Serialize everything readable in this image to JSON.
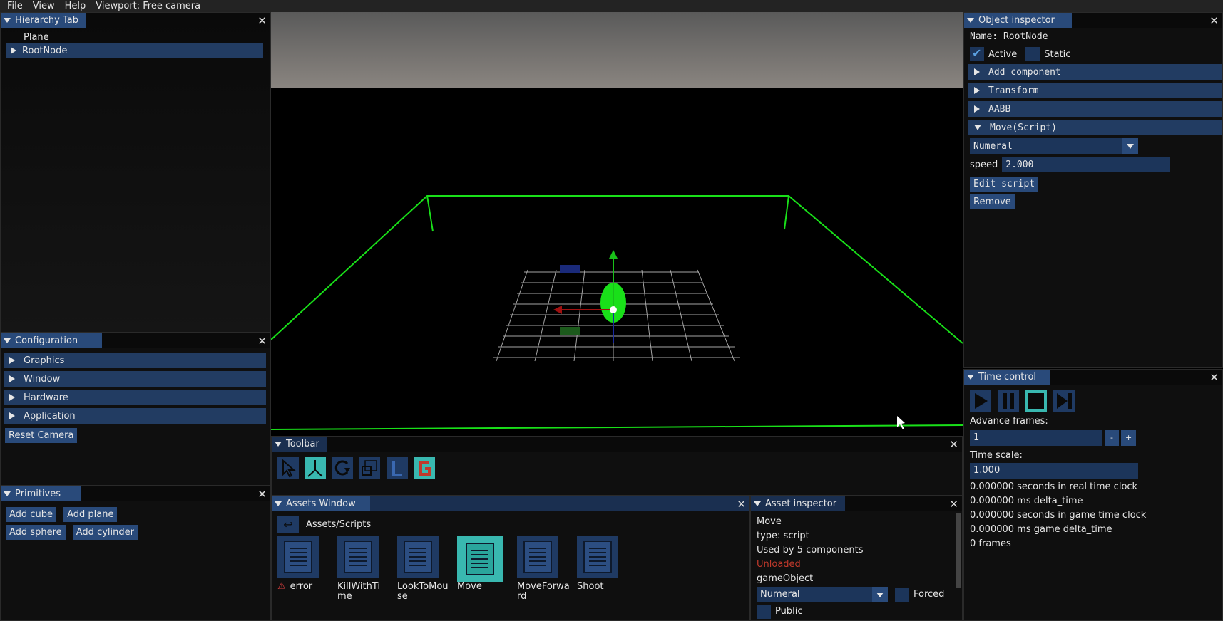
{
  "menu": {
    "file": "File",
    "view": "View",
    "help": "Help",
    "viewport": "Viewport: Free camera"
  },
  "hierarchy": {
    "title": "Hierarchy Tab",
    "items": [
      {
        "label": "Plane"
      },
      {
        "label": "RootNode"
      }
    ]
  },
  "configuration": {
    "title": "Configuration",
    "sections": [
      "Graphics",
      "Window",
      "Hardware",
      "Application"
    ],
    "reset_camera": "Reset Camera"
  },
  "primitives": {
    "title": "Primitives",
    "add_cube": "Add cube",
    "add_plane": "Add plane",
    "add_sphere": "Add sphere",
    "add_cylinder": "Add cylinder"
  },
  "inspector": {
    "title": "Object inspector",
    "name": "Name: RootNode",
    "active": "Active",
    "static": "Static",
    "sections": {
      "add_component": "Add component",
      "transform": "Transform",
      "aabb": "AABB",
      "move": "Move(Script)"
    },
    "mode": "Numeral",
    "speed_label": "speed",
    "speed_value": "2.000",
    "edit_script": "Edit script",
    "remove": "Remove"
  },
  "time_control": {
    "title": "Time control",
    "advance_label": "Advance frames:",
    "advance_value": "1",
    "minus": "-",
    "plus": "+",
    "scale_label": "Time scale:",
    "scale_value": "1.000",
    "stats": [
      "0.000000 seconds in real time clock",
      "0.000000 ms delta_time",
      "0.000000 seconds in game time clock",
      "0.000000 ms game delta_time",
      "0 frames"
    ]
  },
  "toolbar": {
    "title": "Toolbar"
  },
  "assets": {
    "title": "Assets Window",
    "path": "Assets/Scripts",
    "items": [
      {
        "label": "error"
      },
      {
        "label": "KillWithTi me"
      },
      {
        "label": "LookToMou se"
      },
      {
        "label": "Move"
      },
      {
        "label": "MoveForwa rd"
      },
      {
        "label": "Shoot"
      }
    ]
  },
  "asset_inspector": {
    "title": "Asset inspector",
    "name": "Move",
    "type": "type: script",
    "used_by": "Used by 5 components",
    "status": "Unloaded",
    "field": "gameObject",
    "mode": "Numeral",
    "forced": "Forced",
    "public": "Public"
  },
  "colors": {
    "tab": "#294a7a",
    "header": "#223c62",
    "accent_green": "#00ff00",
    "unloaded": "#c0392b"
  }
}
